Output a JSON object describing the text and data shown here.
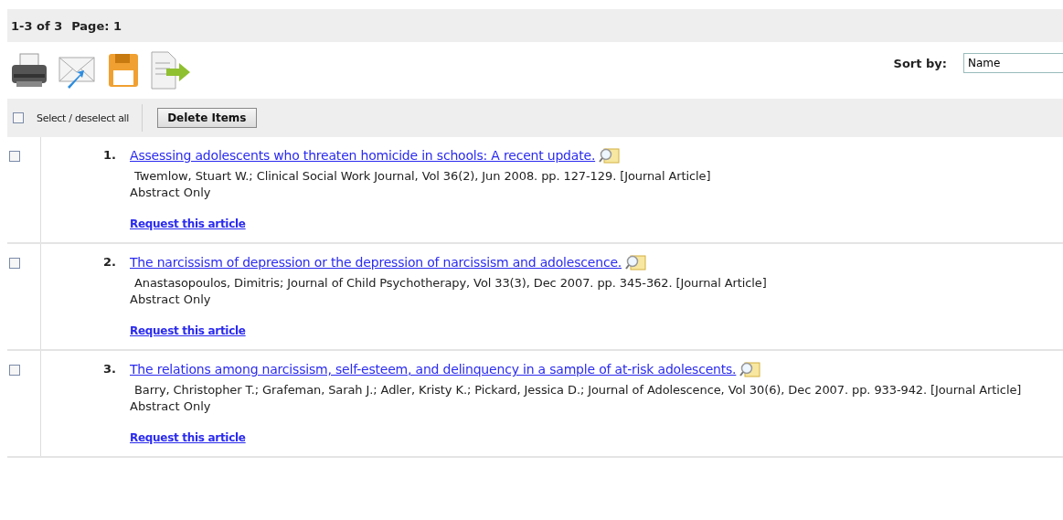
{
  "summary": {
    "range": "1-3 of 3",
    "page": "Page: 1"
  },
  "sort": {
    "label": "Sort by:",
    "value": "Name"
  },
  "select_all": {
    "label": "Select / deselect all",
    "checked": false
  },
  "delete_button": "Delete Items",
  "results": [
    {
      "number": "1.",
      "title": "Assessing adolescents who threaten homicide in schools: A recent update.",
      "citation": "Twemlow, Stuart W.; Clinical Social Work Journal, Vol 36(2), Jun 2008. pp. 127-129. [Journal Article]",
      "availability": "Abstract Only",
      "link": "Request this article",
      "checked": false
    },
    {
      "number": "2.",
      "title": "The narcissism of depression or the depression of narcissism and adolescence.",
      "citation": "Anastasopoulos, Dimitris; Journal of Child Psychotherapy, Vol 33(3), Dec 2007. pp. 345-362. [Journal Article]",
      "availability": "Abstract Only",
      "link": "Request this article",
      "checked": false
    },
    {
      "number": "3.",
      "title": "The relations among narcissism, self-esteem, and delinquency in a sample of at-risk adolescents.",
      "citation": "Barry, Christopher T.; Grafeman, Sarah J.; Adler, Kristy K.; Pickard, Jessica D.; Journal of Adolescence, Vol 30(6), Dec 2007. pp. 933-942. [Journal Article]",
      "availability": "Abstract Only",
      "link": "Request this article",
      "checked": false
    }
  ]
}
